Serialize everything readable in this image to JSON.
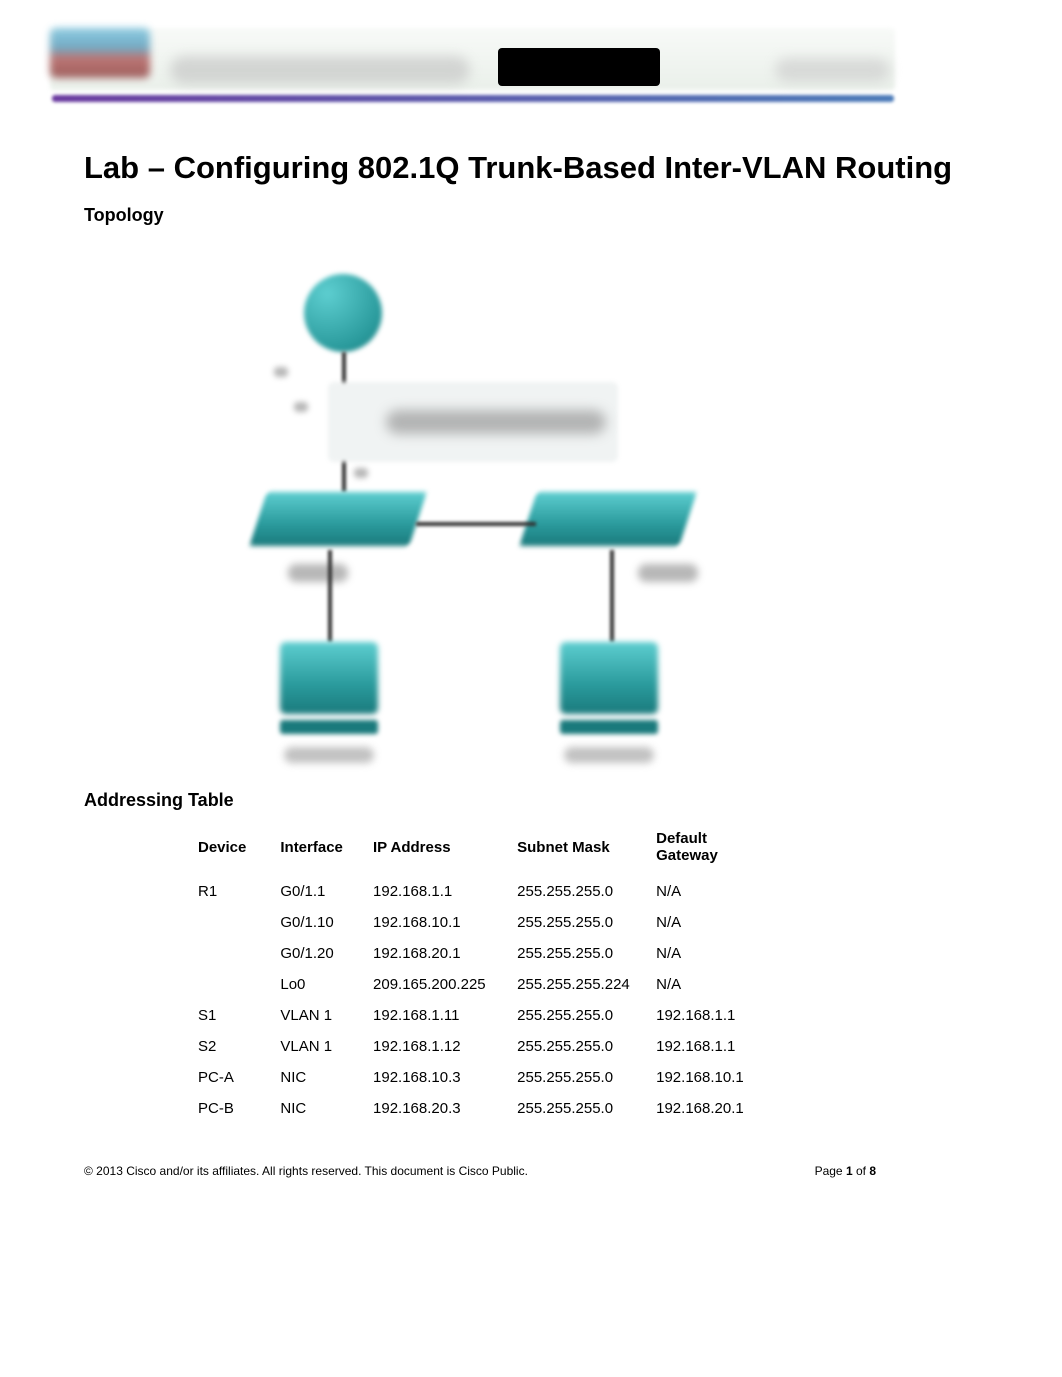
{
  "doc": {
    "title": "Lab – Configuring 802.1Q Trunk-Based Inter-VLAN Routing"
  },
  "sections": {
    "topology": "Topology",
    "addressing": "Addressing Table"
  },
  "table": {
    "headers": {
      "device": "Device",
      "interface": "Interface",
      "ip": "IP Address",
      "mask": "Subnet Mask",
      "gateway": "Default Gateway"
    },
    "rows": [
      {
        "device": "R1",
        "interface": "G0/1.1",
        "ip": "192.168.1.1",
        "mask": "255.255.255.0",
        "gateway": "N/A"
      },
      {
        "device": "",
        "interface": "G0/1.10",
        "ip": "192.168.10.1",
        "mask": "255.255.255.0",
        "gateway": "N/A"
      },
      {
        "device": "",
        "interface": "G0/1.20",
        "ip": "192.168.20.1",
        "mask": "255.255.255.0",
        "gateway": "N/A"
      },
      {
        "device": "",
        "interface": "Lo0",
        "ip": "209.165.200.225",
        "mask": "255.255.255.224",
        "gateway": "N/A"
      },
      {
        "device": "S1",
        "interface": "VLAN 1",
        "ip": "192.168.1.11",
        "mask": "255.255.255.0",
        "gateway": "192.168.1.1"
      },
      {
        "device": "S2",
        "interface": "VLAN 1",
        "ip": "192.168.1.12",
        "mask": "255.255.255.0",
        "gateway": "192.168.1.1"
      },
      {
        "device": "PC-A",
        "interface": "NIC",
        "ip": "192.168.10.3",
        "mask": "255.255.255.0",
        "gateway": "192.168.10.1"
      },
      {
        "device": "PC-B",
        "interface": "NIC",
        "ip": "192.168.20.3",
        "mask": "255.255.255.0",
        "gateway": "192.168.20.1"
      }
    ]
  },
  "footer": {
    "copyright": "© 2013 Cisco and/or its affiliates. All rights reserved. This document is Cisco Public.",
    "page_prefix": "Page ",
    "page_current": "1",
    "page_sep": " of ",
    "page_total": "8"
  }
}
